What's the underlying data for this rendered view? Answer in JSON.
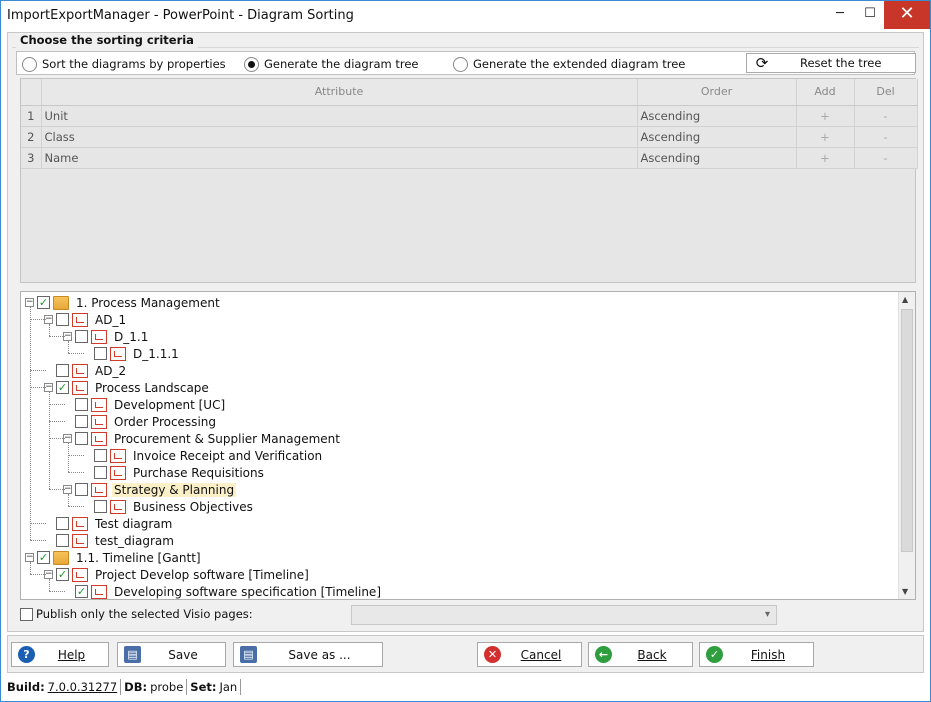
{
  "window": {
    "title": "ImportExportManager - PowerPoint - Diagram Sorting",
    "minimize": "─",
    "maximize": "☐",
    "close": "✕"
  },
  "criteria": {
    "section_title": "Choose the sorting criteria",
    "radios": [
      {
        "label": "Sort the diagrams by properties",
        "selected": false
      },
      {
        "label": "Generate the diagram tree",
        "selected": true
      },
      {
        "label": "Generate the extended diagram tree",
        "selected": false
      }
    ],
    "reset_label": "Reset the tree"
  },
  "grid": {
    "headers": {
      "attribute": "Attribute",
      "order": "Order",
      "add": "Add",
      "del": "Del"
    },
    "rows": [
      {
        "num": "1",
        "attribute": "Unit",
        "order": "Ascending",
        "add": "+",
        "del": "-"
      },
      {
        "num": "2",
        "attribute": "Class",
        "order": "Ascending",
        "add": "+",
        "del": "-"
      },
      {
        "num": "3",
        "attribute": "Name",
        "order": "Ascending",
        "add": "+",
        "del": "-"
      }
    ]
  },
  "tree": {
    "nodes": [
      {
        "label": "1. Process Management",
        "level": 0,
        "expander": "⊟",
        "checked": true,
        "icon": "folder-icon"
      },
      {
        "label": "AD_1",
        "level": 1,
        "expander": "⊟",
        "checked": false,
        "icon": "diagram-icon"
      },
      {
        "label": "D_1.1",
        "level": 2,
        "expander": "⊟",
        "checked": false,
        "icon": "diagram-icon"
      },
      {
        "label": "D_1.1.1",
        "level": 3,
        "expander": "",
        "checked": false,
        "icon": "diagram-icon"
      },
      {
        "label": "AD_2",
        "level": 1,
        "expander": "",
        "checked": false,
        "icon": "diagram-icon"
      },
      {
        "label": "Process Landscape",
        "level": 1,
        "expander": "⊟",
        "checked": true,
        "icon": "diagram-icon"
      },
      {
        "label": "Development [UC]",
        "level": 2,
        "expander": "",
        "checked": false,
        "icon": "diagram-icon"
      },
      {
        "label": "Order Processing",
        "level": 2,
        "expander": "",
        "checked": false,
        "icon": "diagram-icon"
      },
      {
        "label": "Procurement & Supplier Management",
        "level": 2,
        "expander": "⊟",
        "checked": false,
        "icon": "diagram-icon"
      },
      {
        "label": "Invoice Receipt and Verification",
        "level": 3,
        "expander": "",
        "checked": false,
        "icon": "diagram-icon"
      },
      {
        "label": "Purchase Requisitions",
        "level": 3,
        "expander": "",
        "checked": false,
        "icon": "diagram-icon"
      },
      {
        "label": "Strategy & Planning",
        "level": 2,
        "expander": "⊟",
        "checked": false,
        "icon": "diagram-icon",
        "highlighted": true
      },
      {
        "label": "Business Objectives",
        "level": 3,
        "expander": "",
        "checked": false,
        "icon": "diagram-icon"
      },
      {
        "label": "Test diagram",
        "level": 1,
        "expander": "",
        "checked": false,
        "icon": "diagram-icon"
      },
      {
        "label": "test_diagram",
        "level": 1,
        "expander": "",
        "checked": false,
        "icon": "diagram-icon"
      },
      {
        "label": "1.1. Timeline [Gantt]",
        "level": 0,
        "expander": "⊟",
        "checked": true,
        "icon": "folder-icon"
      },
      {
        "label": "Project Develop software [Timeline]",
        "level": 1,
        "expander": "⊟",
        "checked": true,
        "icon": "diagram-icon"
      },
      {
        "label": "Developing software specification [Timeline]",
        "level": 2,
        "expander": "",
        "checked": true,
        "icon": "diagram-icon"
      }
    ]
  },
  "publish": {
    "label": "Publish only the selected Visio pages:",
    "dropdown_value": ""
  },
  "buttons": {
    "help": "Help",
    "save": "Save",
    "save_as": "Save as ...",
    "cancel": "Cancel",
    "back": "Back",
    "finish": "Finish"
  },
  "status": {
    "build_label": "Build:",
    "build_value": "7.0.0.31277",
    "db_label": "DB:",
    "db_value": "probe",
    "set_label": "Set:",
    "set_value": "Jan"
  },
  "colors": {
    "title_border": "#3b8bd3",
    "close_red": "#c8362a",
    "check_green": "#1a9a2a",
    "help_blue": "#1a5fb4",
    "cancel_red": "#d32f2f",
    "ok_green": "#2e9e3e",
    "highlight": "#fbf0c8"
  }
}
